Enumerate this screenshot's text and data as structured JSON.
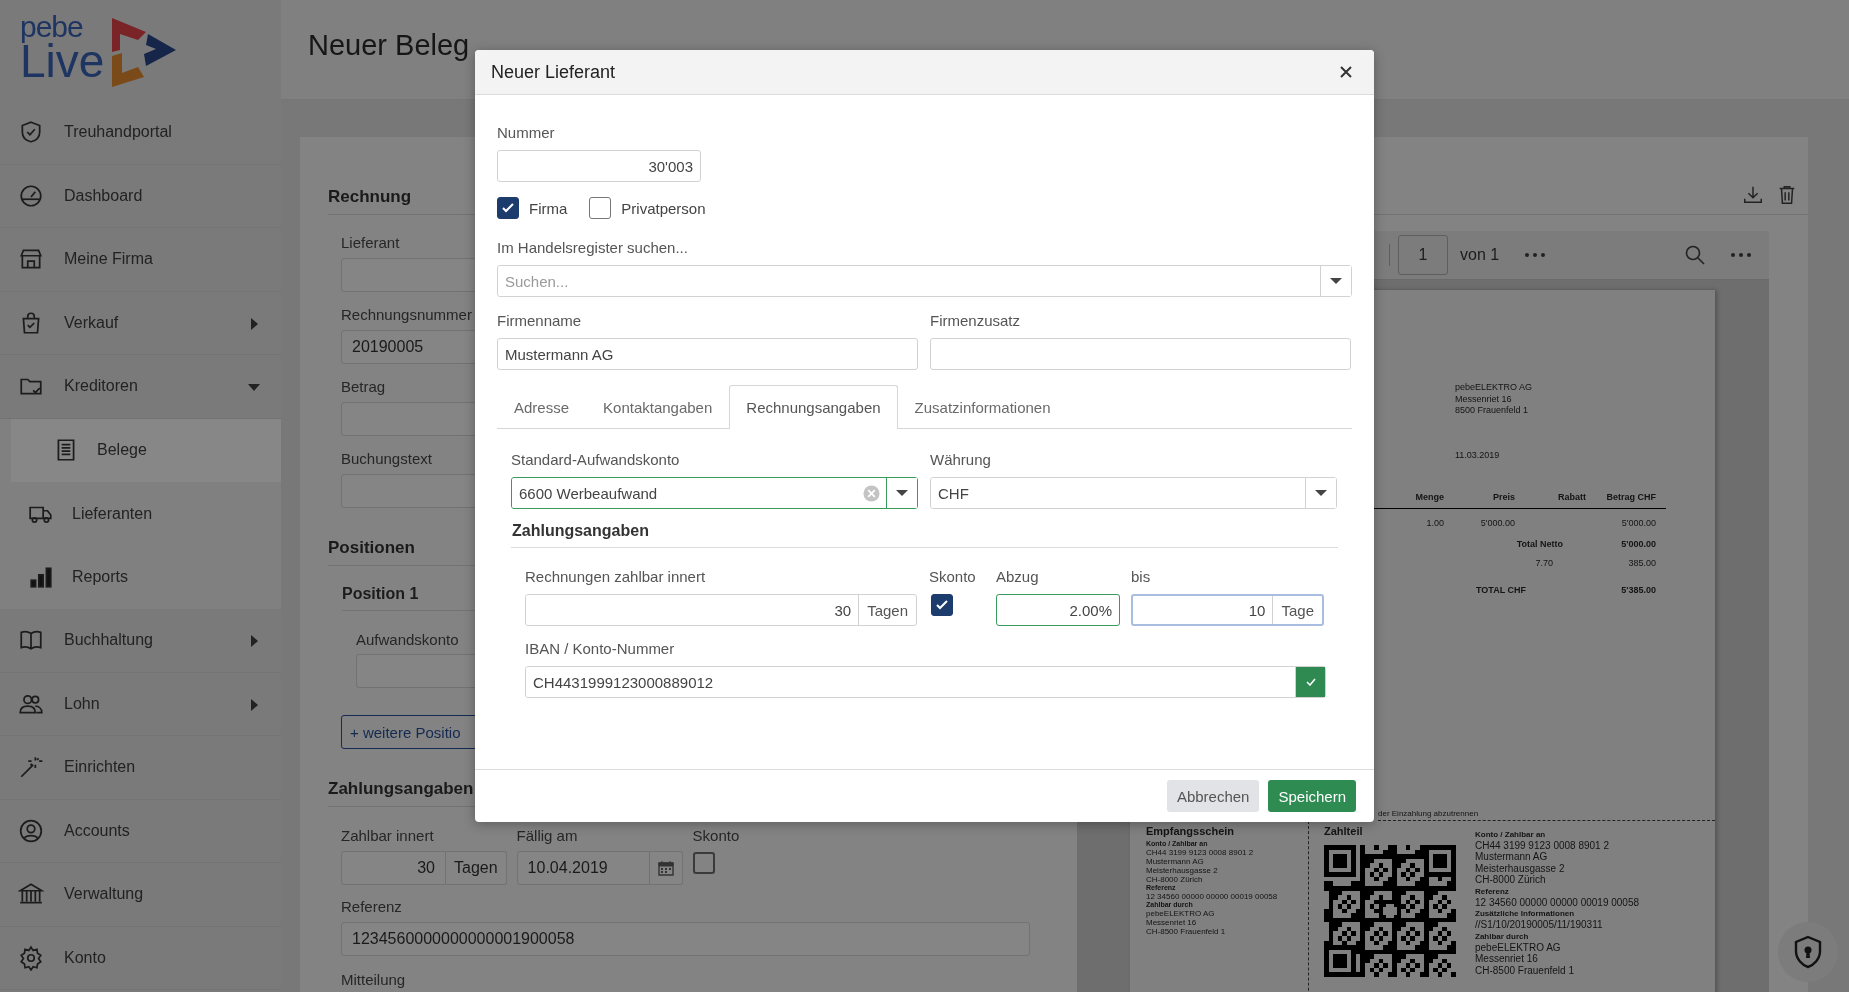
{
  "sidebar": {
    "logo": {
      "top": "pebe",
      "bottom": "Live"
    },
    "items": [
      {
        "label": "Treuhandportal",
        "selected": false
      },
      {
        "label": "Dashboard",
        "selected": false
      },
      {
        "label": "Meine Firma",
        "selected": false
      },
      {
        "label": "Verkauf",
        "selected": false,
        "expanded": false
      },
      {
        "label": "Kreditoren",
        "selected": false,
        "expanded": true,
        "children": [
          {
            "label": "Belege",
            "selected": true
          },
          {
            "label": "Lieferanten",
            "selected": false
          },
          {
            "label": "Reports",
            "selected": false
          }
        ]
      },
      {
        "label": "Buchhaltung",
        "selected": false,
        "expanded": false
      },
      {
        "label": "Lohn",
        "selected": false,
        "expanded": false
      },
      {
        "label": "Einrichten",
        "selected": false
      },
      {
        "label": "Accounts",
        "selected": false
      },
      {
        "label": "Verwaltung",
        "selected": false
      },
      {
        "label": "Konto",
        "selected": false
      }
    ]
  },
  "page": {
    "title": "Neuer Beleg"
  },
  "form": {
    "invoice": {
      "heading": "Rechnung",
      "fields": [
        {
          "label": "Lieferant"
        },
        {
          "label": "Rechnungsnummer",
          "value": "20190005"
        },
        {
          "label": "Betrag"
        },
        {
          "label": "Buchungstext"
        }
      ]
    },
    "positions": {
      "heading": "Positionen",
      "items": [
        {
          "heading": "Position 1",
          "fields": [
            {
              "label": "Aufwandskonto"
            }
          ]
        }
      ],
      "add_button": "+ weitere Positio"
    },
    "payment": {
      "heading": "Zahlungsangaben",
      "terms": {
        "label": "Zahlbar innert",
        "value": "30",
        "unit": "Tagen"
      },
      "due": {
        "label": "Fällig am",
        "value": "10.04.2019"
      },
      "discount": {
        "label": "Skonto",
        "checked": false
      },
      "reference": {
        "label": "Referenz",
        "value": "1234560000000000001900058"
      },
      "message": {
        "label": "Mitteilung"
      }
    }
  },
  "viewer": {
    "page_input": "1",
    "page_total": "von 1",
    "document": {
      "address": [
        "pebeELEKTRO AG",
        "Messenriet 16",
        "8500 Frauenfeld 1"
      ],
      "date": "11.03.2019",
      "columns": [
        "Menge",
        "Preis",
        "Rabatt",
        "Betrag CHF"
      ],
      "rows": [
        {
          "menge": "1.00",
          "preis": "5'000.00",
          "betrag": "5'000.00"
        }
      ],
      "totals": [
        {
          "label": "Total Netto",
          "value": "5'000.00",
          "bold": true
        },
        {
          "label": "7.70",
          "value": "385.00",
          "bold": false
        },
        {
          "label": "TOTAL  CHF",
          "value": "5'385.00",
          "bold": true
        }
      ],
      "slip": {
        "cut_note": "der Einzahlung abzutrennen",
        "receipt": {
          "title": "Empfangsschein",
          "blocks": [
            {
              "heading": "Konto / Zahlbar an",
              "lines": [
                "CH44 3199 9123 0008 8901 2",
                "Mustermann AG",
                "Meisterhausgasse 2",
                "CH-8000 Zürich"
              ]
            },
            {
              "heading": "Referenz",
              "lines": [
                "12 34560 00000 00000 00019 00058"
              ]
            },
            {
              "heading": "Zahlbar durch",
              "lines": [
                "pebeELEKTRO AG",
                "Messenriet 16",
                "CH-8500 Frauenfeld 1"
              ]
            }
          ]
        },
        "payment_part": {
          "title": "Zahlteil",
          "blocks": [
            {
              "heading": "Konto / Zahlbar an",
              "lines": [
                "CH44 3199 9123 0008 8901 2",
                "Mustermann AG",
                "Meisterhausgasse 2",
                "CH-8000 Zürich"
              ]
            },
            {
              "heading": "Referenz",
              "lines": [
                "12 34560 00000 00000 00019 00058"
              ]
            },
            {
              "heading": "Zusätzliche Informationen",
              "lines": [
                "//S1/10/20190005/11/190311"
              ]
            },
            {
              "heading": "Zahlbar durch",
              "lines": [
                "pebeELEKTRO AG",
                "Messenriet 16",
                "CH-8500 Frauenfeld 1"
              ]
            }
          ]
        }
      }
    }
  },
  "modal": {
    "title": "Neuer Lieferant",
    "number": {
      "label": "Nummer",
      "value": "30'003"
    },
    "person_types": [
      {
        "label": "Firma",
        "checked": true
      },
      {
        "label": "Privatperson",
        "checked": false
      }
    ],
    "register_search": {
      "label": "Im Handelsregister suchen...",
      "placeholder": "Suchen..."
    },
    "company_name": {
      "label": "Firmenname",
      "value": "Mustermann AG"
    },
    "company_suffix": {
      "label": "Firmenzusatz"
    },
    "tabs": [
      {
        "label": "Adresse",
        "selected": false
      },
      {
        "label": "Kontaktangaben",
        "selected": false
      },
      {
        "label": "Rechnungsangaben",
        "selected": true
      },
      {
        "label": "Zusatzinformationen",
        "selected": false
      }
    ],
    "expense_account": {
      "label": "Standard-Aufwandskonto",
      "value": "6600 Werbeaufwand",
      "valid": true
    },
    "currency": {
      "label": "Währung",
      "value": "CHF"
    },
    "payment": {
      "heading": "Zahlungsangaben",
      "terms": {
        "label": "Rechnungen zahlbar innert",
        "value": "30",
        "unit": "Tagen"
      },
      "discount": {
        "label": "Skonto",
        "checked": true
      },
      "deduction": {
        "label": "Abzug",
        "value": "2.00%",
        "valid": true
      },
      "until": {
        "label": "bis",
        "value": "10",
        "unit": "Tage",
        "focused": true
      },
      "iban": {
        "label": "IBAN / Konto-Nummer",
        "value": "CH4431999123000889012",
        "valid": true
      }
    },
    "buttons": [
      {
        "label": "Abbrechen",
        "kind": "secondary"
      },
      {
        "label": "Speichern",
        "kind": "primary"
      }
    ]
  }
}
